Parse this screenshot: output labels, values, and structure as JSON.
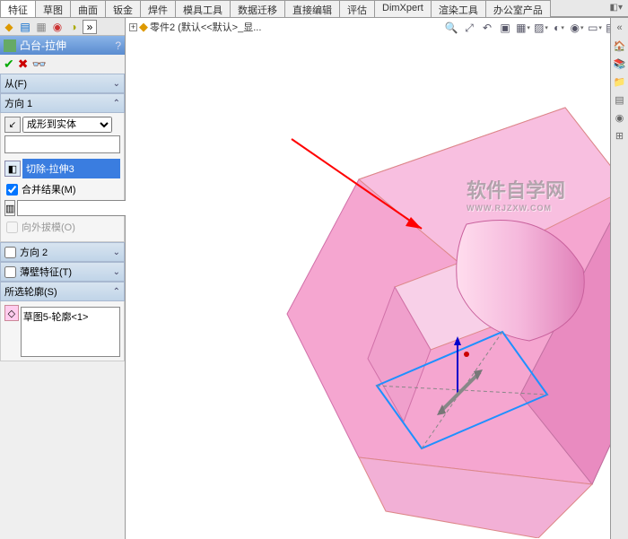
{
  "tabs": {
    "t0": "特征",
    "t1": "草图",
    "t2": "曲面",
    "t3": "钣金",
    "t4": "焊件",
    "t5": "模具工具",
    "t6": "数据迁移",
    "t7": "直接编辑",
    "t8": "评估",
    "t9": "DimXpert",
    "t10": "渲染工具",
    "t11": "办公室产品"
  },
  "feature": {
    "title": "凸台-拉伸",
    "help": "?"
  },
  "sections": {
    "from": {
      "title": "从(F)"
    },
    "dir1": {
      "title": "方向 1",
      "type": "成形到实体",
      "face": "切除-拉伸3",
      "merge": "合并结果(M)",
      "draft_out": "向外拔模(O)"
    },
    "dir2": {
      "title": "方向 2"
    },
    "thin": {
      "title": "薄壁特征(T)"
    },
    "contour": {
      "title": "所选轮廓(S)",
      "item": "草图5-轮廓<1>"
    }
  },
  "tree": {
    "part": "零件2 (默认<<默认>_显..."
  },
  "watermark": {
    "main": "软件自学网",
    "sub": "WWW.RJZXW.COM"
  }
}
